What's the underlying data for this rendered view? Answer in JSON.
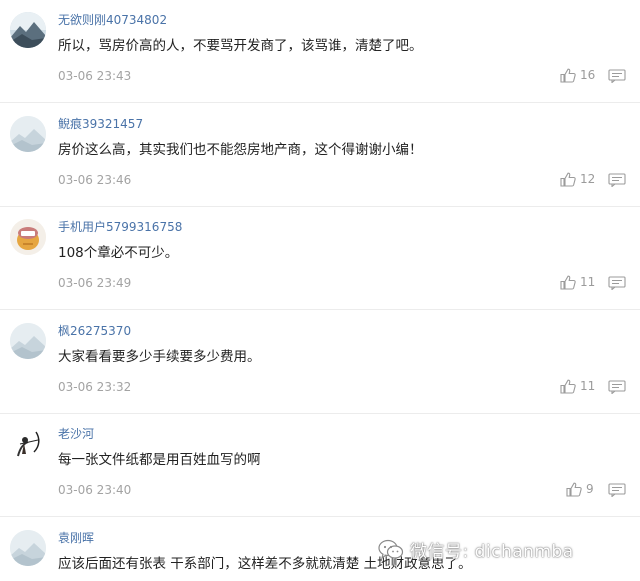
{
  "comments": [
    {
      "user": "无欲则刚40734802",
      "text": "所以，骂房价高的人，不要骂开发商了，该骂谁，清楚了吧。",
      "time": "03-06 23:43",
      "likes": "16",
      "avatar": "landscape-avatar"
    },
    {
      "user": "鲵痕39321457",
      "text": "房价这么高，其实我们也不能怨房地产商，这个得谢谢小编！",
      "time": "03-06 23:46",
      "likes": "12",
      "avatar": "default-avatar"
    },
    {
      "user": "手机用户5799316758",
      "text": "108个章必不可少。",
      "time": "03-06 23:49",
      "likes": "11",
      "avatar": "cartoon-avatar"
    },
    {
      "user": "枫26275370",
      "text": "大家看看要多少手续要多少费用。",
      "time": "03-06 23:32",
      "likes": "11",
      "avatar": "default-avatar"
    },
    {
      "user": "老沙河",
      "text": "每一张文件纸都是用百姓血写的啊",
      "time": "03-06 23:40",
      "likes": "9",
      "avatar": "archer-avatar"
    },
    {
      "user": "袁刚晖",
      "text": "应该后面还有张表 干系部门，这样差不多就就清楚 土地财政意思了。",
      "time": "",
      "likes": "",
      "avatar": "default-avatar"
    }
  ],
  "watermark": {
    "text": "微信号: dichanmba",
    "icon": "wechat-icon"
  }
}
